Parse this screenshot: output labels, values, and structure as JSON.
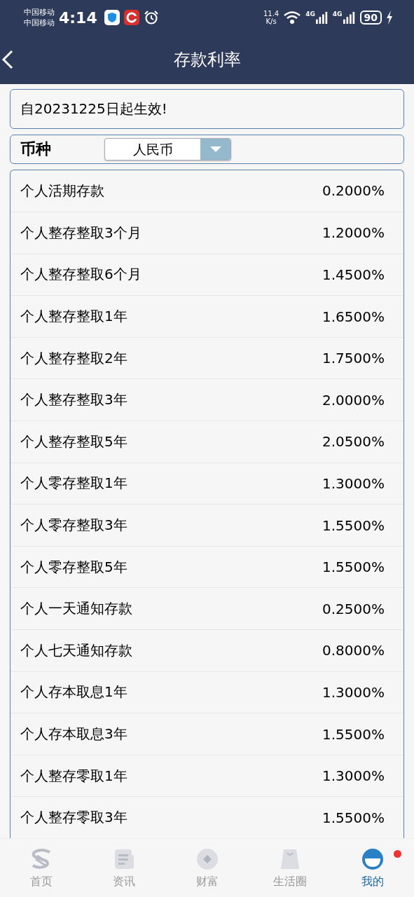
{
  "status_bar": {
    "carriers": [
      "中国移动",
      "中国移动"
    ],
    "time": "4:14",
    "speed": [
      "11.4",
      "K/s"
    ],
    "networks": [
      "4G",
      "4G"
    ],
    "battery": "90"
  },
  "header": {
    "title": "存款利率"
  },
  "notice": "自20231225日起生效!",
  "currency": {
    "label": "币种",
    "value": "人民币"
  },
  "rates": [
    {
      "name": "个人活期存款",
      "rate": "0.2000%"
    },
    {
      "name": "个人整存整取3个月",
      "rate": "1.2000%"
    },
    {
      "name": "个人整存整取6个月",
      "rate": "1.4500%"
    },
    {
      "name": "个人整存整取1年",
      "rate": "1.6500%"
    },
    {
      "name": "个人整存整取2年",
      "rate": "1.7500%"
    },
    {
      "name": "个人整存整取3年",
      "rate": "2.0000%"
    },
    {
      "name": "个人整存整取5年",
      "rate": "2.0500%"
    },
    {
      "name": "个人零存整取1年",
      "rate": "1.3000%"
    },
    {
      "name": "个人零存整取3年",
      "rate": "1.5500%"
    },
    {
      "name": "个人零存整取5年",
      "rate": "1.5500%"
    },
    {
      "name": "个人一天通知存款",
      "rate": "0.2500%"
    },
    {
      "name": "个人七天通知存款",
      "rate": "0.8000%"
    },
    {
      "name": "个人存本取息1年",
      "rate": "1.3000%"
    },
    {
      "name": "个人存本取息3年",
      "rate": "1.5500%"
    },
    {
      "name": "个人整存零取1年",
      "rate": "1.3000%"
    },
    {
      "name": "个人整存零取3年",
      "rate": "1.5500%"
    }
  ],
  "tab_bar": [
    {
      "kind": "home",
      "label": "首页",
      "selected": false,
      "badge": false
    },
    {
      "kind": "news",
      "label": "资讯",
      "selected": false,
      "badge": false
    },
    {
      "kind": "wealth",
      "label": "财富",
      "selected": false,
      "badge": false
    },
    {
      "kind": "life",
      "label": "生活圈",
      "selected": false,
      "badge": false
    },
    {
      "kind": "me",
      "label": "我的",
      "selected": true,
      "badge": true
    }
  ]
}
